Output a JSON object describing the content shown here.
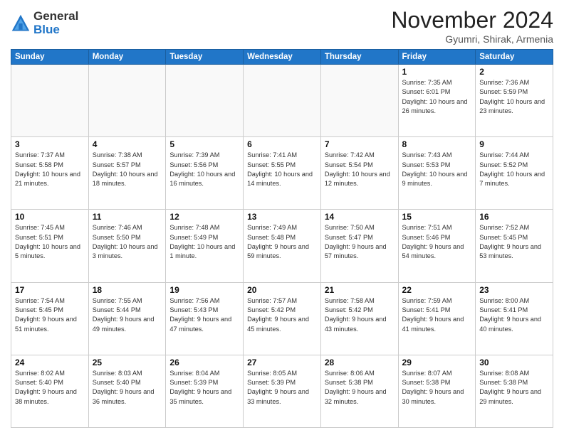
{
  "logo": {
    "line1": "General",
    "line2": "Blue"
  },
  "header": {
    "month": "November 2024",
    "location": "Gyumri, Shirak, Armenia"
  },
  "weekdays": [
    "Sunday",
    "Monday",
    "Tuesday",
    "Wednesday",
    "Thursday",
    "Friday",
    "Saturday"
  ],
  "weeks": [
    [
      {
        "day": "",
        "info": ""
      },
      {
        "day": "",
        "info": ""
      },
      {
        "day": "",
        "info": ""
      },
      {
        "day": "",
        "info": ""
      },
      {
        "day": "",
        "info": ""
      },
      {
        "day": "1",
        "info": "Sunrise: 7:35 AM\nSunset: 6:01 PM\nDaylight: 10 hours and 26 minutes."
      },
      {
        "day": "2",
        "info": "Sunrise: 7:36 AM\nSunset: 5:59 PM\nDaylight: 10 hours and 23 minutes."
      }
    ],
    [
      {
        "day": "3",
        "info": "Sunrise: 7:37 AM\nSunset: 5:58 PM\nDaylight: 10 hours and 21 minutes."
      },
      {
        "day": "4",
        "info": "Sunrise: 7:38 AM\nSunset: 5:57 PM\nDaylight: 10 hours and 18 minutes."
      },
      {
        "day": "5",
        "info": "Sunrise: 7:39 AM\nSunset: 5:56 PM\nDaylight: 10 hours and 16 minutes."
      },
      {
        "day": "6",
        "info": "Sunrise: 7:41 AM\nSunset: 5:55 PM\nDaylight: 10 hours and 14 minutes."
      },
      {
        "day": "7",
        "info": "Sunrise: 7:42 AM\nSunset: 5:54 PM\nDaylight: 10 hours and 12 minutes."
      },
      {
        "day": "8",
        "info": "Sunrise: 7:43 AM\nSunset: 5:53 PM\nDaylight: 10 hours and 9 minutes."
      },
      {
        "day": "9",
        "info": "Sunrise: 7:44 AM\nSunset: 5:52 PM\nDaylight: 10 hours and 7 minutes."
      }
    ],
    [
      {
        "day": "10",
        "info": "Sunrise: 7:45 AM\nSunset: 5:51 PM\nDaylight: 10 hours and 5 minutes."
      },
      {
        "day": "11",
        "info": "Sunrise: 7:46 AM\nSunset: 5:50 PM\nDaylight: 10 hours and 3 minutes."
      },
      {
        "day": "12",
        "info": "Sunrise: 7:48 AM\nSunset: 5:49 PM\nDaylight: 10 hours and 1 minute."
      },
      {
        "day": "13",
        "info": "Sunrise: 7:49 AM\nSunset: 5:48 PM\nDaylight: 9 hours and 59 minutes."
      },
      {
        "day": "14",
        "info": "Sunrise: 7:50 AM\nSunset: 5:47 PM\nDaylight: 9 hours and 57 minutes."
      },
      {
        "day": "15",
        "info": "Sunrise: 7:51 AM\nSunset: 5:46 PM\nDaylight: 9 hours and 54 minutes."
      },
      {
        "day": "16",
        "info": "Sunrise: 7:52 AM\nSunset: 5:45 PM\nDaylight: 9 hours and 53 minutes."
      }
    ],
    [
      {
        "day": "17",
        "info": "Sunrise: 7:54 AM\nSunset: 5:45 PM\nDaylight: 9 hours and 51 minutes."
      },
      {
        "day": "18",
        "info": "Sunrise: 7:55 AM\nSunset: 5:44 PM\nDaylight: 9 hours and 49 minutes."
      },
      {
        "day": "19",
        "info": "Sunrise: 7:56 AM\nSunset: 5:43 PM\nDaylight: 9 hours and 47 minutes."
      },
      {
        "day": "20",
        "info": "Sunrise: 7:57 AM\nSunset: 5:42 PM\nDaylight: 9 hours and 45 minutes."
      },
      {
        "day": "21",
        "info": "Sunrise: 7:58 AM\nSunset: 5:42 PM\nDaylight: 9 hours and 43 minutes."
      },
      {
        "day": "22",
        "info": "Sunrise: 7:59 AM\nSunset: 5:41 PM\nDaylight: 9 hours and 41 minutes."
      },
      {
        "day": "23",
        "info": "Sunrise: 8:00 AM\nSunset: 5:41 PM\nDaylight: 9 hours and 40 minutes."
      }
    ],
    [
      {
        "day": "24",
        "info": "Sunrise: 8:02 AM\nSunset: 5:40 PM\nDaylight: 9 hours and 38 minutes."
      },
      {
        "day": "25",
        "info": "Sunrise: 8:03 AM\nSunset: 5:40 PM\nDaylight: 9 hours and 36 minutes."
      },
      {
        "day": "26",
        "info": "Sunrise: 8:04 AM\nSunset: 5:39 PM\nDaylight: 9 hours and 35 minutes."
      },
      {
        "day": "27",
        "info": "Sunrise: 8:05 AM\nSunset: 5:39 PM\nDaylight: 9 hours and 33 minutes."
      },
      {
        "day": "28",
        "info": "Sunrise: 8:06 AM\nSunset: 5:38 PM\nDaylight: 9 hours and 32 minutes."
      },
      {
        "day": "29",
        "info": "Sunrise: 8:07 AM\nSunset: 5:38 PM\nDaylight: 9 hours and 30 minutes."
      },
      {
        "day": "30",
        "info": "Sunrise: 8:08 AM\nSunset: 5:38 PM\nDaylight: 9 hours and 29 minutes."
      }
    ]
  ]
}
